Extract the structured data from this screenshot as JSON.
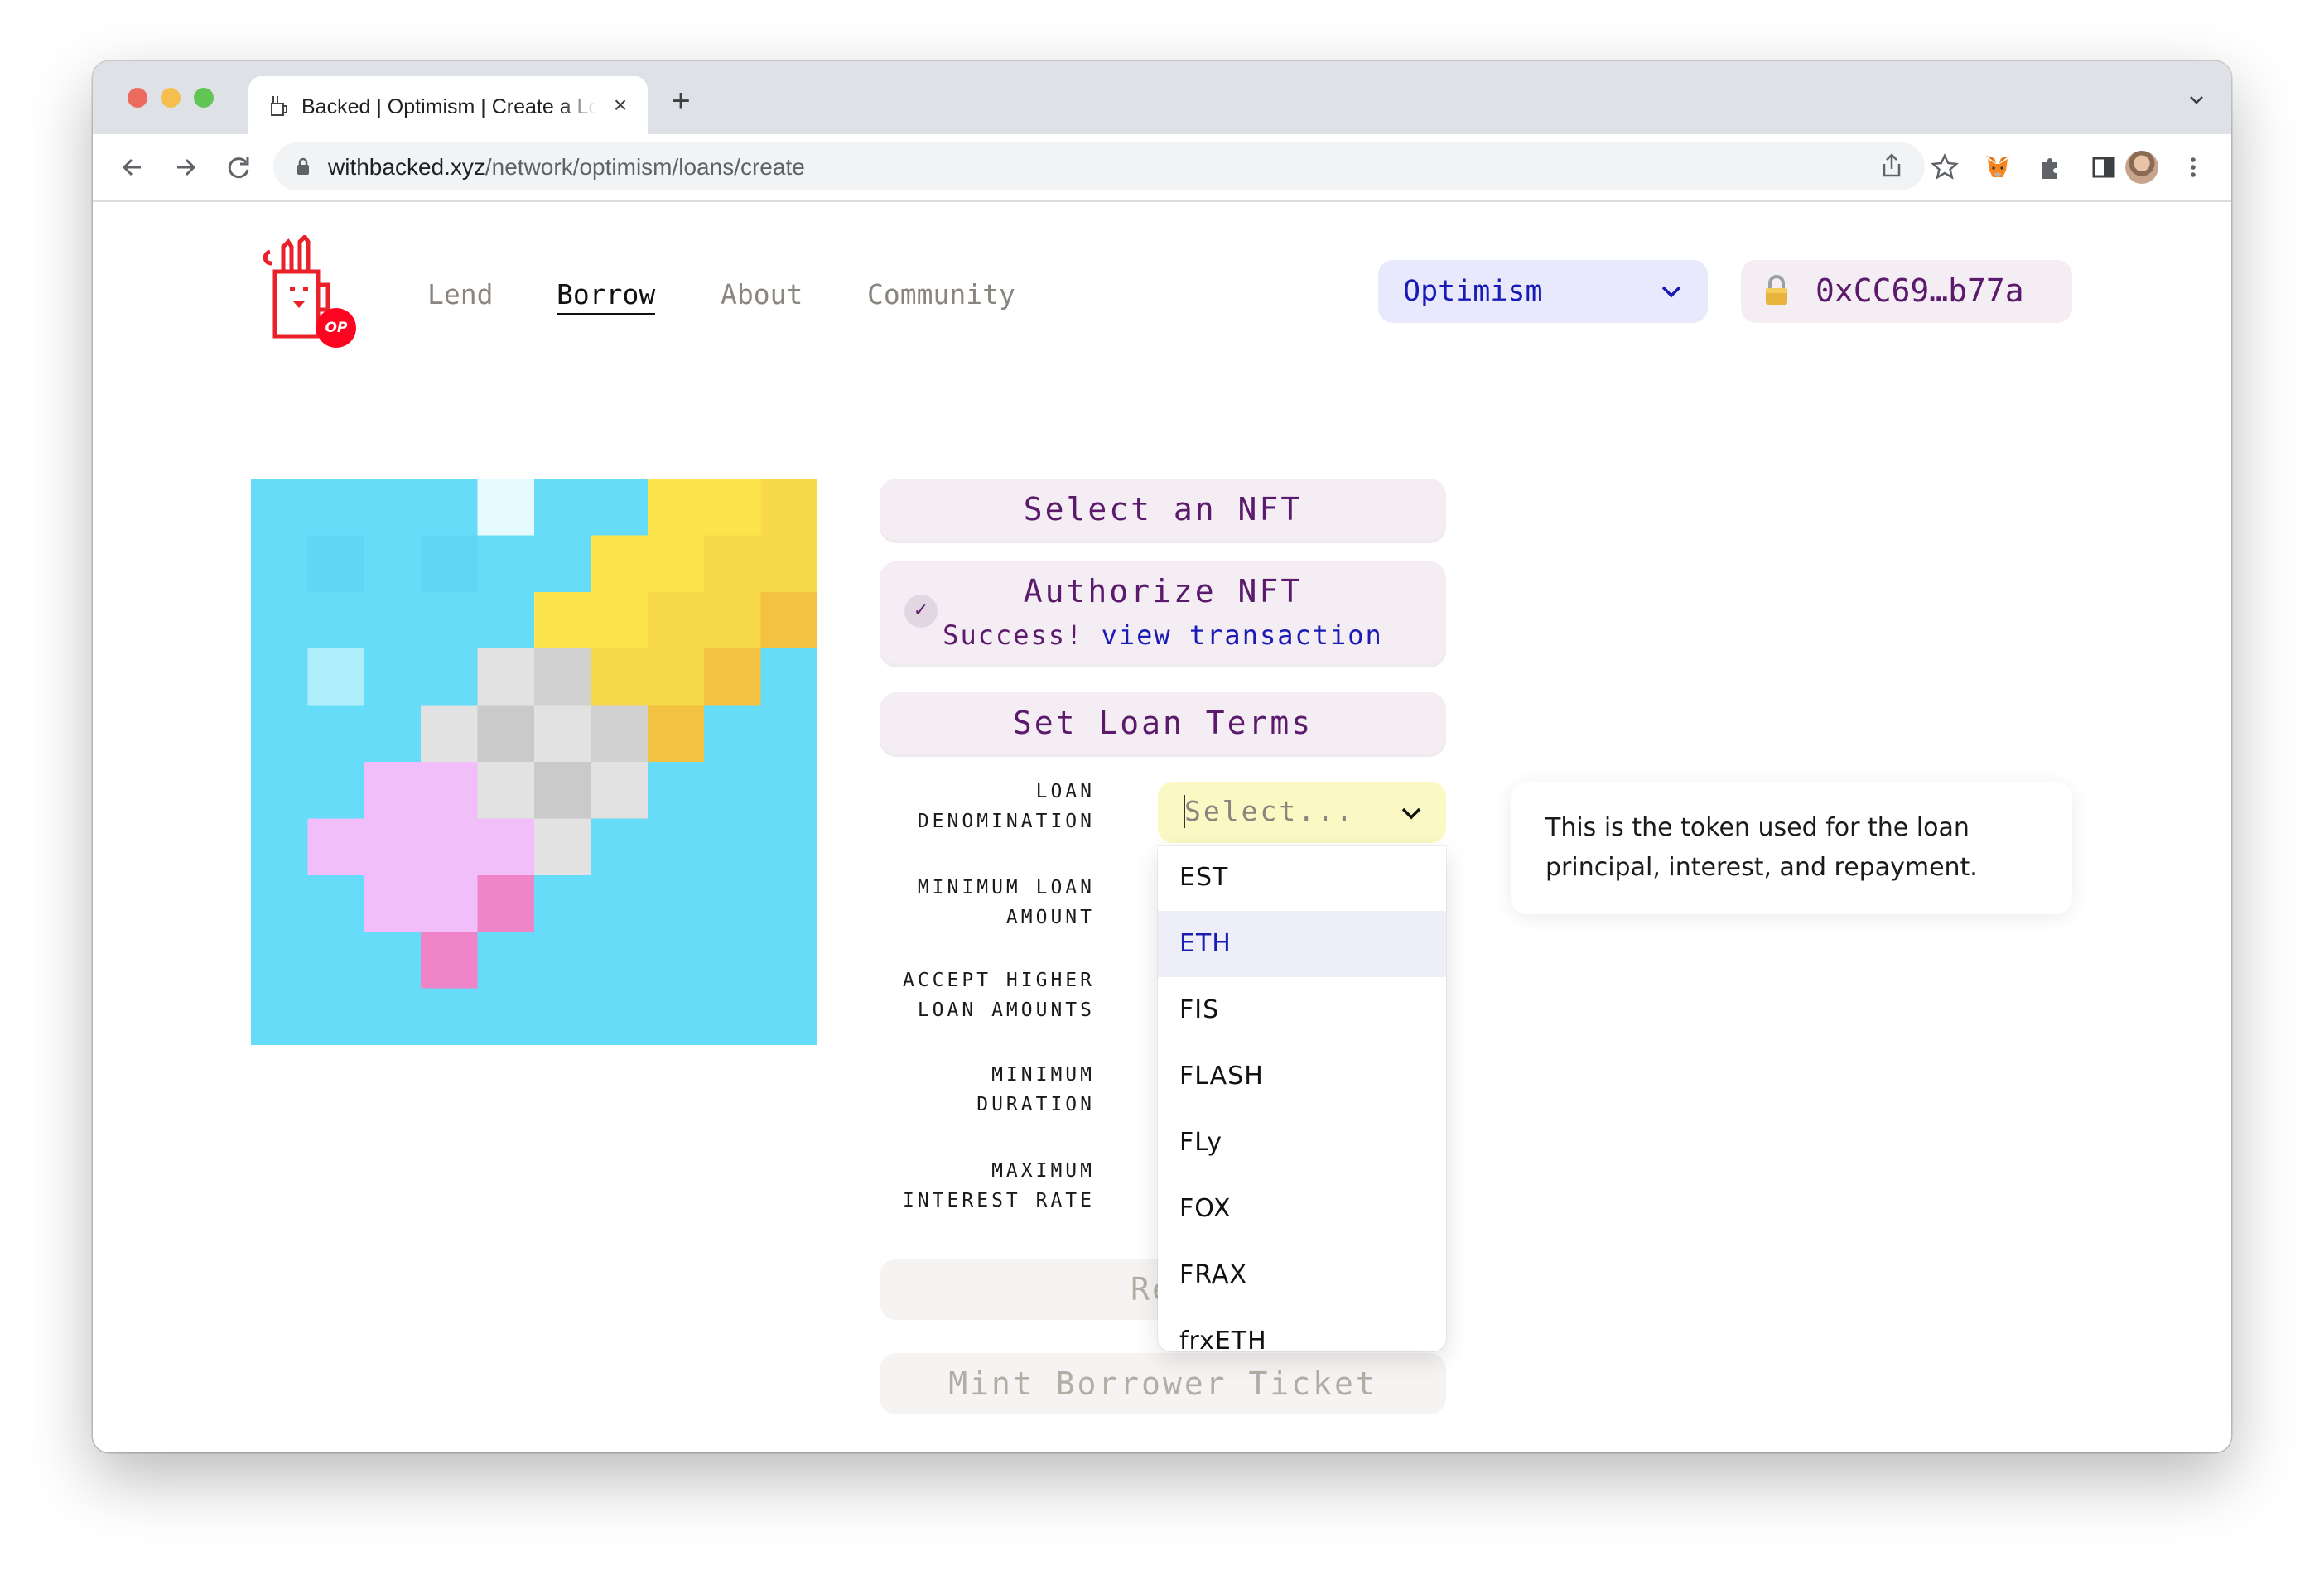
{
  "browser": {
    "tab_title": "Backed | Optimism | Create a Loan",
    "tab_close": "×",
    "new_tab": "+",
    "url_host": "withbacked.xyz",
    "url_path": "/network/optimism/loans/create"
  },
  "logo": {
    "badge": "OP"
  },
  "nav": {
    "lend": "Lend",
    "borrow": "Borrow",
    "about": "About",
    "community": "Community"
  },
  "network": {
    "selected": "Optimism"
  },
  "wallet": {
    "address": "0xCC69…b77a"
  },
  "steps": {
    "select_nft": "Select an NFT",
    "authorize_nft": "Authorize NFT",
    "authorize_success": "Success!",
    "authorize_link": "view transaction",
    "authorize_check": "✓",
    "set_loan_terms": "Set Loan Terms",
    "review": "Rev",
    "mint": "Mint Borrower Ticket"
  },
  "form": {
    "loan_denomination": [
      "LOAN",
      "DENOMINATION"
    ],
    "minimum_loan_amount": [
      "MINIMUM LOAN",
      "AMOUNT"
    ],
    "accept_higher": [
      "ACCEPT HIGHER",
      "LOAN AMOUNTS"
    ],
    "minimum_duration": [
      "MINIMUM",
      "DURATION"
    ],
    "maximum_interest_rate": [
      "MAXIMUM",
      "INTEREST RATE"
    ],
    "denomination_placeholder": "Select...",
    "options": [
      "EST",
      "ETH",
      "FIS",
      "FLASH",
      "FLy",
      "FOX",
      "FRAX",
      "frxETH"
    ],
    "highlighted_option": "ETH"
  },
  "tooltip": {
    "line1": "This is the token used for the loan",
    "line2": "principal, interest, and repayment."
  },
  "colors": {
    "accent_purple": "#5b1a6b",
    "link_blue": "#1a1ab5",
    "nft_sky": "#66dcf9",
    "select_yellow": "#fbf8c3"
  },
  "icons": [
    "back-arrow-icon",
    "forward-arrow-icon",
    "reload-icon",
    "lock-icon",
    "share-icon",
    "star-icon",
    "metamask-fox-icon",
    "extensions-puzzle-icon",
    "side-panel-icon",
    "menu-dots-icon",
    "chevron-down-icon",
    "padlock-icon",
    "check-icon"
  ]
}
